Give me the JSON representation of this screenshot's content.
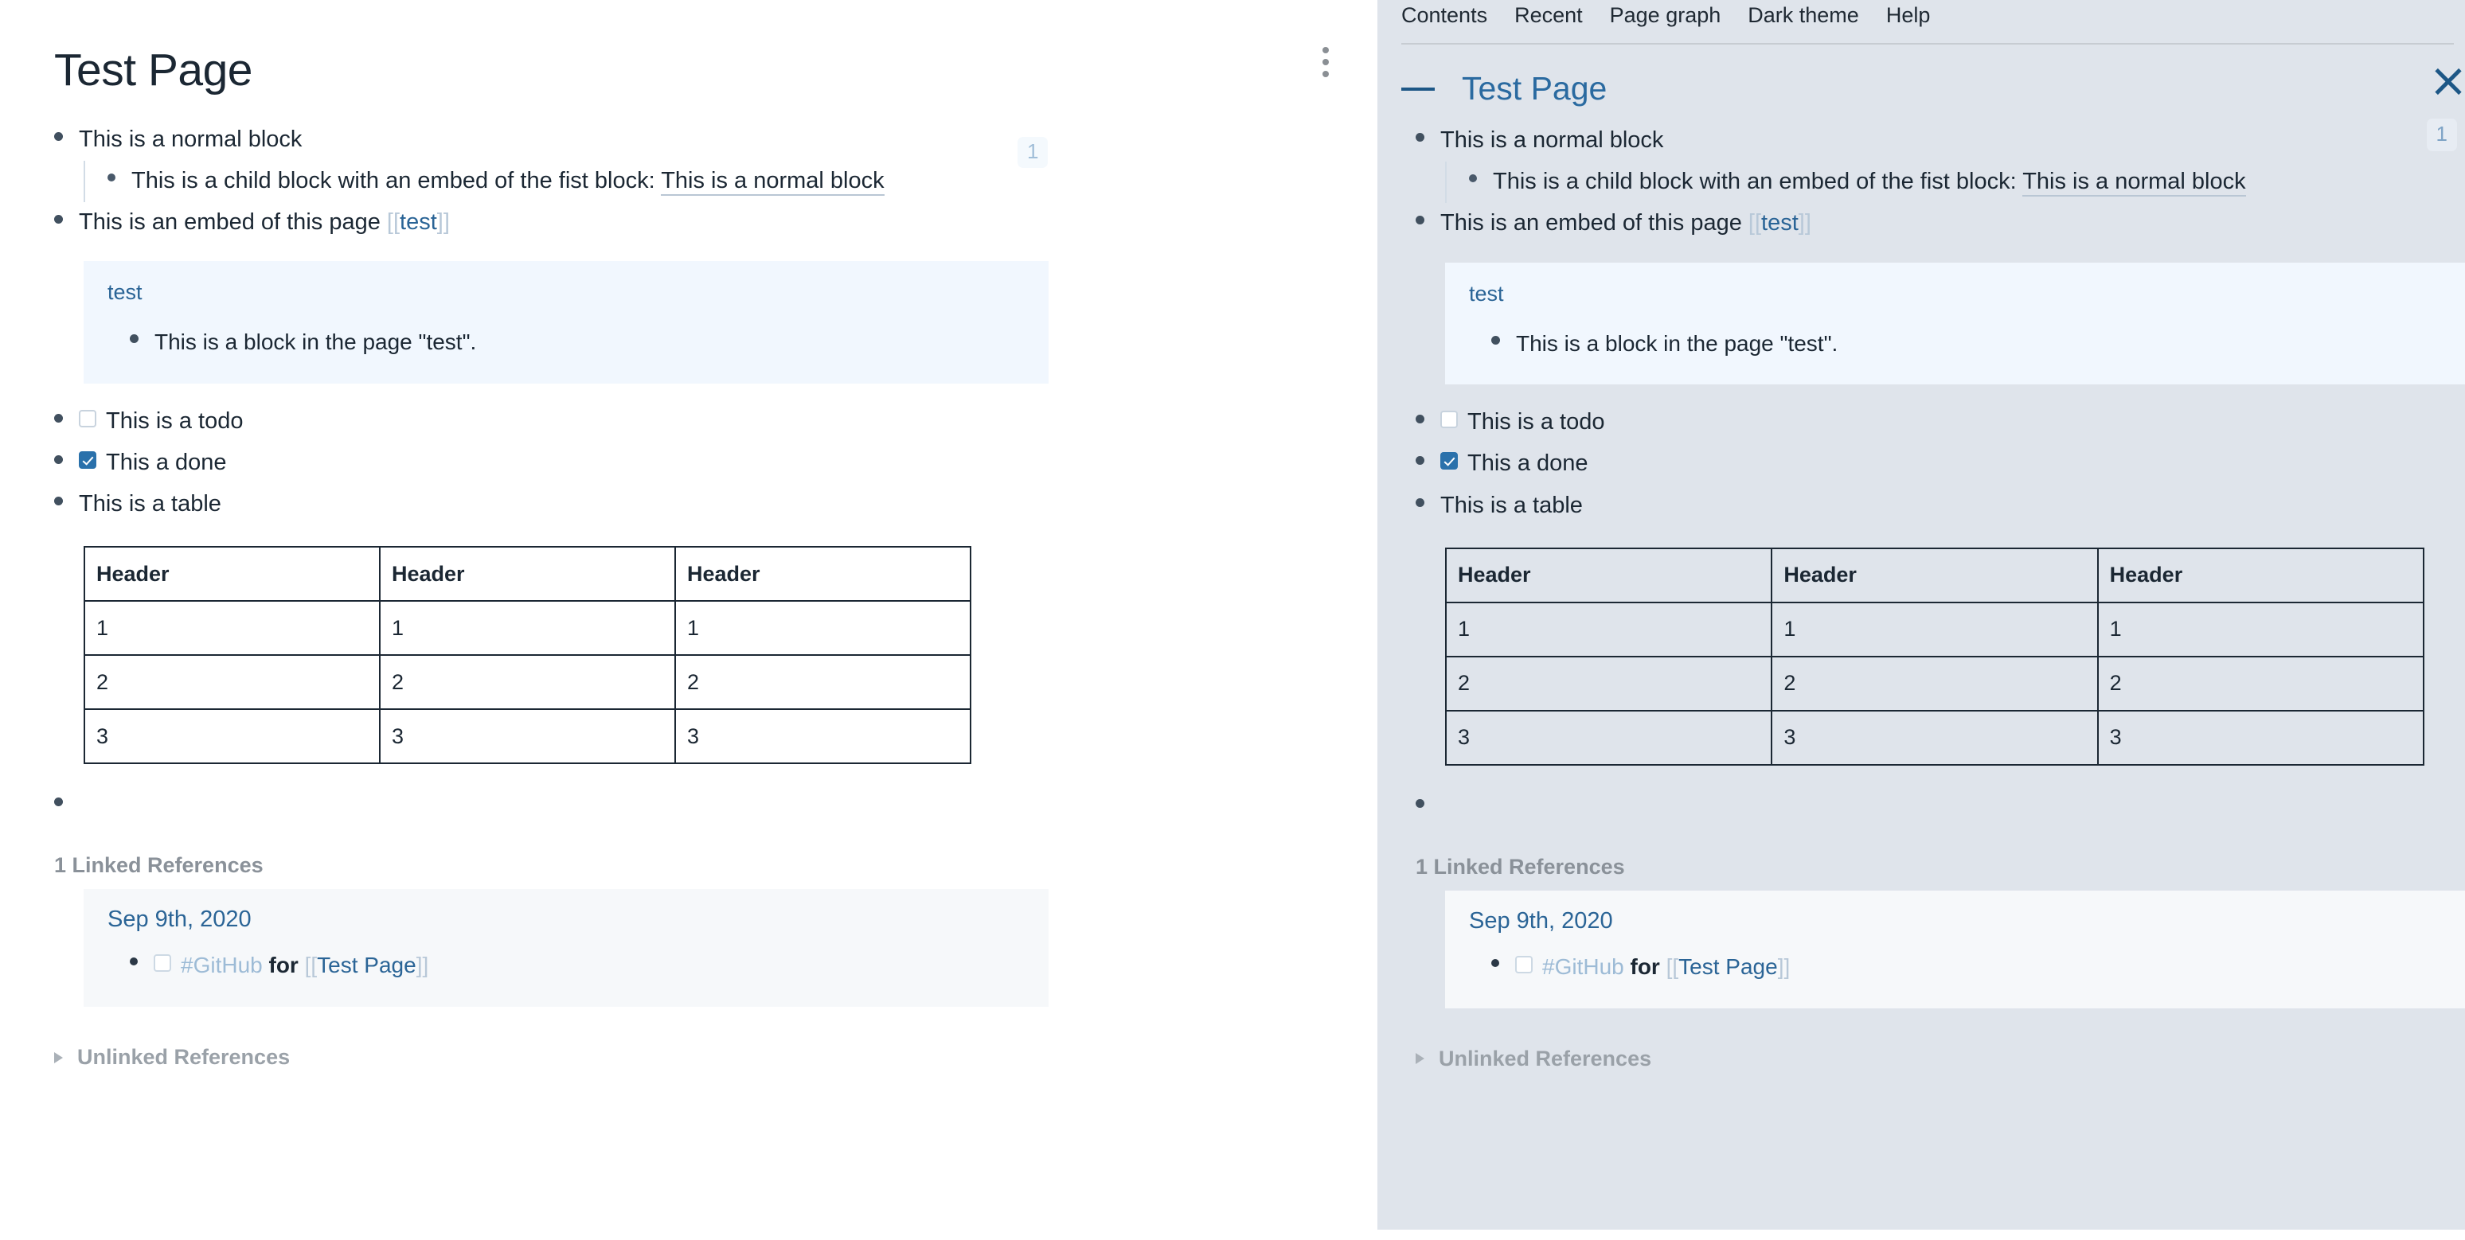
{
  "page": {
    "title": "Test Page",
    "ref_badge": "1"
  },
  "topbar": {
    "items": [
      {
        "label": "Contents"
      },
      {
        "label": "Recent"
      },
      {
        "label": "Page graph"
      },
      {
        "label": "Dark theme"
      },
      {
        "label": "Help"
      }
    ]
  },
  "blocks": {
    "b1": "This is a normal block",
    "b1_child_prefix": "This is a child block with an embed of the fist block: ",
    "b1_child_ref": "This is a normal block",
    "b2_prefix": "This is an embed of this page ",
    "b2_link_open": "[[",
    "b2_link": "test",
    "b2_link_close": "]]",
    "todo": "This is a todo",
    "done": "This a done",
    "table_intro": "This is a table"
  },
  "embed": {
    "title": "test",
    "body": "This is a block in the page \"test\"."
  },
  "table": {
    "headers": [
      "Header",
      "Header",
      "Header"
    ],
    "rows": [
      [
        "1",
        "1",
        "1"
      ],
      [
        "2",
        "2",
        "2"
      ],
      [
        "3",
        "3",
        "3"
      ]
    ]
  },
  "references": {
    "linked_title": "1 Linked References",
    "date": "Sep 9th, 2020",
    "tag": "#GitHub",
    "for": "for",
    "link_open": "[[",
    "link": "Test Page",
    "link_close": "]]",
    "unlinked_title": "Unlinked References"
  },
  "right_panel": {
    "title": "Test Page",
    "close_icon": "close-icon",
    "collapse_icon": "minus-icon"
  },
  "colors": {
    "accent_blue": "#2a6496",
    "link_blue": "#2a6aa0",
    "panel_bg": "#dfe4eb",
    "embed_bg": "#f1f7fe",
    "ref_bg": "#f6f8fa",
    "text": "#1b2733",
    "muted": "#8a9199",
    "checkbox_checked": "#2a71ab"
  }
}
